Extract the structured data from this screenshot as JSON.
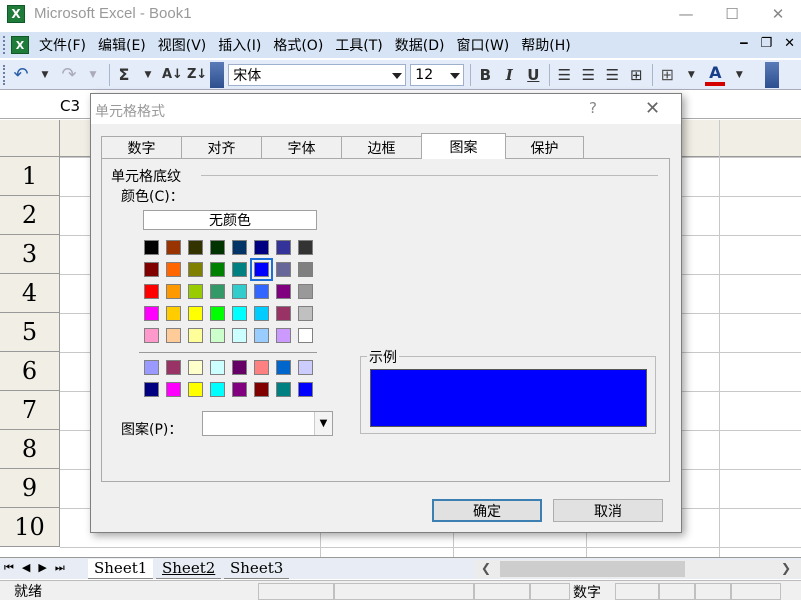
{
  "window": {
    "title": "Microsoft Excel - Book1",
    "app_icon": "X",
    "controls": [
      "minimize-icon",
      "maximize-icon",
      "close-icon"
    ]
  },
  "menubar": {
    "items": [
      "文件(F)",
      "编辑(E)",
      "视图(V)",
      "插入(I)",
      "格式(O)",
      "工具(T)",
      "数据(D)",
      "窗口(W)",
      "帮助(H)"
    ],
    "mdi_buttons": [
      "‒",
      "❐",
      "✕"
    ]
  },
  "toolbar": {
    "undo": "↶",
    "redo": "↷",
    "sum": "Σ",
    "sort_asc": "A↓",
    "sort_desc": "Z↓",
    "font_name": "宋体",
    "font_size": "12",
    "bold": "B",
    "italic": "I",
    "underline": "U",
    "font_color": "#d40000"
  },
  "namebox": {
    "value": "C3"
  },
  "grid": {
    "rows": [
      "1",
      "2",
      "3",
      "4",
      "5",
      "6",
      "7",
      "8",
      "9",
      "10"
    ]
  },
  "sheets": {
    "tabs": [
      "Sheet1",
      "Sheet2",
      "Sheet3"
    ],
    "active": "Sheet1"
  },
  "status": {
    "ready": "就绪",
    "numlock": "数字"
  },
  "dialog": {
    "title": "单元格格式",
    "help": "?",
    "close": "✕",
    "tabs": [
      "数字",
      "对齐",
      "字体",
      "边框",
      "图案",
      "保护"
    ],
    "active_tab": "图案",
    "group_title": "单元格底纹",
    "color_label": "颜色(C)：",
    "no_color": "无颜色",
    "palette": [
      [
        "#000000",
        "#993300",
        "#333300",
        "#003300",
        "#003366",
        "#000080",
        "#333399",
        "#333333"
      ],
      [
        "#800000",
        "#FF6600",
        "#808000",
        "#008000",
        "#008080",
        "#0000FF",
        "#666699",
        "#808080"
      ],
      [
        "#FF0000",
        "#FF9900",
        "#99CC00",
        "#339966",
        "#33CCCC",
        "#3366FF",
        "#800080",
        "#999999"
      ],
      [
        "#FF00FF",
        "#FFCC00",
        "#FFFF00",
        "#00FF00",
        "#00FFFF",
        "#00CCFF",
        "#993366",
        "#C0C0C0"
      ],
      [
        "#FF99CC",
        "#FFCC99",
        "#FFFF99",
        "#CCFFCC",
        "#CCFFFF",
        "#99CCFF",
        "#CC99FF",
        "#FFFFFF"
      ]
    ],
    "palette_extra": [
      [
        "#9999FF",
        "#993366",
        "#FFFFCC",
        "#CCFFFF",
        "#660066",
        "#FF8080",
        "#0066CC",
        "#CCCCFF"
      ],
      [
        "#000080",
        "#FF00FF",
        "#FFFF00",
        "#00FFFF",
        "#800080",
        "#800000",
        "#008080",
        "#0000FF"
      ]
    ],
    "selected_color": "#0000FF",
    "sample_label": "示例",
    "sample_color": "#0000FF",
    "pattern_label": "图案(P)：",
    "ok": "确定",
    "cancel": "取消"
  }
}
